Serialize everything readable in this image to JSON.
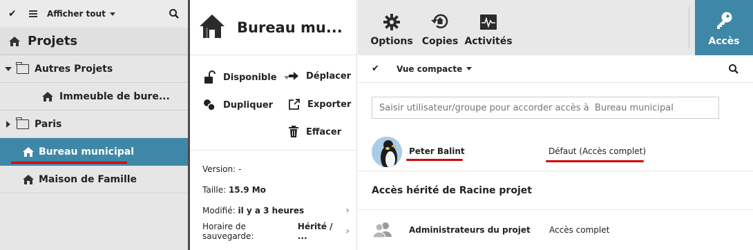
{
  "left": {
    "toolbar": {
      "show_all_label": "Afficher tout"
    },
    "projects_title": "Projets",
    "tree": [
      {
        "label": "Autres Projets",
        "type": "folder",
        "expanded": true
      },
      {
        "label": "Immeuble de bure...",
        "type": "house"
      },
      {
        "label": "Paris",
        "type": "folder",
        "expanded": false
      },
      {
        "label": "Bureau municipal",
        "type": "house",
        "selected": true
      },
      {
        "label": "Maison de Famille",
        "type": "house"
      }
    ]
  },
  "middle": {
    "title": "Bureau mu...",
    "actions": {
      "available": "Disponible",
      "move": "Déplacer",
      "duplicate": "Dupliquer",
      "export": "Exporter",
      "delete": "Effacer"
    },
    "props": {
      "version_label": "Version:",
      "version_value": "-",
      "size_label": "Taille:",
      "size_value": "15.9 Mo",
      "modified_label": "Modifié:",
      "modified_value": "il y a 3 heures",
      "backup_label": "Horaire de sauvegarde:",
      "backup_value": "Hérité / ..."
    }
  },
  "right": {
    "tabs": {
      "options": "Options",
      "copies": "Copies",
      "activities": "Activités",
      "access": "Accès"
    },
    "view_label": "Vue compacte",
    "grant_placeholder": "Saisir utilisateur/groupe pour accorder accès à  Bureau municipal",
    "user": {
      "name": "Peter Balint",
      "access": "Défaut  (Accès complet)"
    },
    "inherited_title": "Accès hérité de Racine projet",
    "group": {
      "name": "Administrateurs du projet",
      "access": "Accès complet"
    }
  },
  "colors": {
    "accent": "#3f87a6",
    "underline": "#d40000"
  }
}
